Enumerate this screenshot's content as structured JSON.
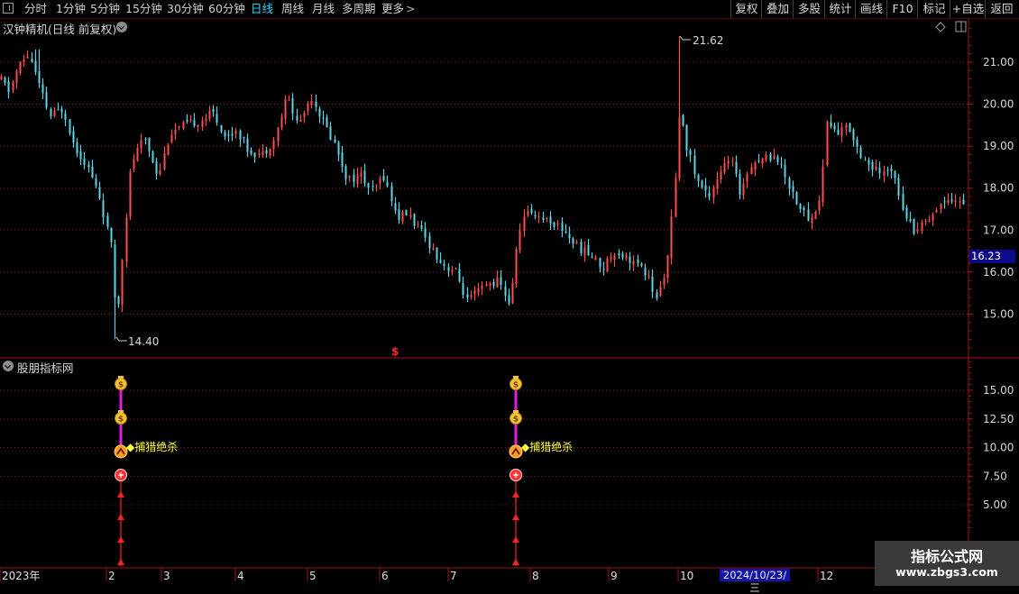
{
  "toolbar": {
    "tabs": [
      {
        "label": "分时",
        "active": false
      },
      {
        "label": "1分钟",
        "active": false
      },
      {
        "label": "5分钟",
        "active": false
      },
      {
        "label": "15分钟",
        "active": false
      },
      {
        "label": "30分钟",
        "active": false
      },
      {
        "label": "60分钟",
        "active": false
      },
      {
        "label": "日线",
        "active": true
      },
      {
        "label": "周线",
        "active": false
      },
      {
        "label": "月线",
        "active": false
      },
      {
        "label": "多周期",
        "active": false
      },
      {
        "label": "更多",
        "active": false
      }
    ],
    "more_arrow": ">",
    "right_buttons": [
      "复权",
      "叠加",
      "多股",
      "统计",
      "画线",
      "F10",
      "标记",
      "+自选",
      "返回"
    ]
  },
  "main_chart": {
    "title": "汉钟精机(日线 前复权)",
    "high_label": "21.62",
    "low_label": "14.40",
    "current_price": "16.23",
    "money_marker": "$",
    "y_axis": {
      "ticks": [
        21.0,
        20.0,
        19.0,
        18.0,
        17.0,
        16.0,
        15.0
      ],
      "labels": [
        "21.00",
        "20.00",
        "19.00",
        "18.00",
        "17.00",
        "16.00",
        "15.00"
      ]
    }
  },
  "indicator": {
    "title": "股朋指标网",
    "signal_label": "◆捕猎绝杀",
    "y_axis": {
      "labels": [
        "15.00",
        "12.50",
        "10.00",
        "7.50",
        "5.00"
      ]
    },
    "signals": [
      {
        "position": "early-feb",
        "label": "◆捕猎绝杀"
      },
      {
        "position": "late-jul",
        "label": "◆捕猎绝杀"
      }
    ]
  },
  "x_axis": {
    "labels": [
      "2023年",
      "2",
      "3",
      "4",
      "5",
      "6",
      "7",
      "8",
      "9",
      "10",
      "12"
    ],
    "crosshair_date": "2024/10/23/三"
  },
  "watermark": {
    "line1": "指标公式网",
    "line2": "www.zbgs3.com"
  },
  "colors": {
    "up": "#ff4d4d",
    "down": "#5fd3e6",
    "grid": "#8a1a1a",
    "active_tab": "#2bd9ff",
    "signal_line": "#e020e0",
    "arrow": "#ff2020",
    "text_yellow": "#ffff3a"
  },
  "chart_data": {
    "type": "candlestick",
    "series": [
      {
        "values": []
      }
    ],
    "ylim": [
      14.0,
      22.0
    ],
    "high": 21.62,
    "low": 14.4,
    "last": 16.23,
    "indicator_ylim": [
      2.5,
      17.5
    ]
  }
}
